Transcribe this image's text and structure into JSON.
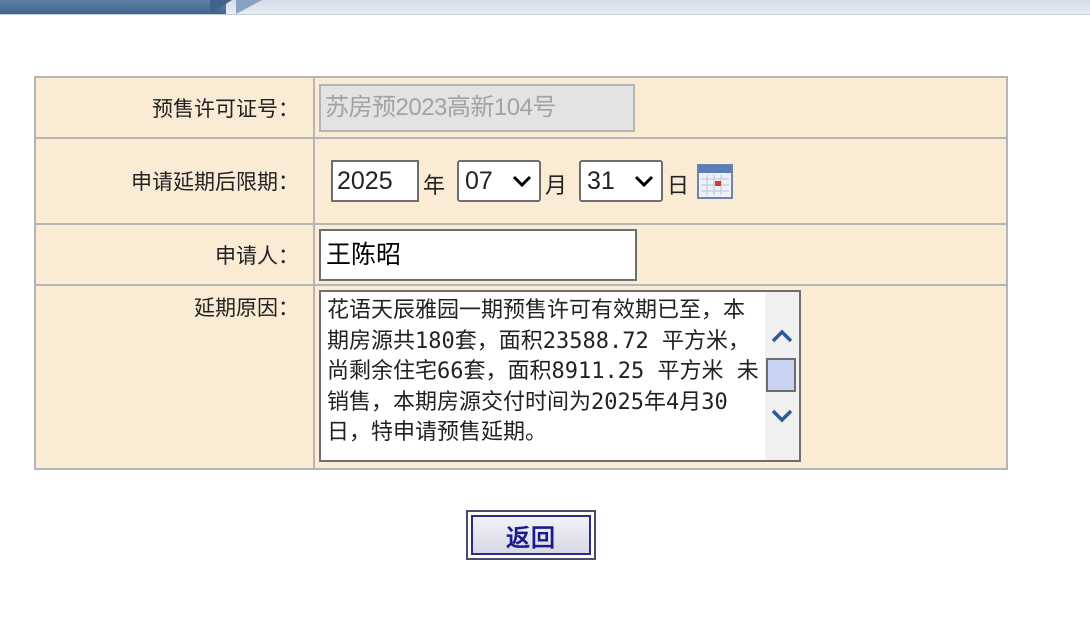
{
  "form": {
    "permit_label": "预售许可证号：",
    "permit_value": "苏房预2023高新104号",
    "deadline_label": "申请延期后限期：",
    "year_value": "2025",
    "year_unit": "年",
    "month_value": "07",
    "month_unit": "月",
    "day_value": "31",
    "day_unit": "日",
    "applicant_label": "申请人：",
    "applicant_value": "王陈昭",
    "reason_label": "延期原因：",
    "reason_value": "花语天辰雅园一期预售许可有效期已至，本期房源共180套，面积23588.72 平方米，尚剩余住宅66套，面积8911.25 平方米 未销售，本期房源交付时间为2025年4月30日，特申请预售延期。"
  },
  "actions": {
    "back_label": "返回"
  },
  "icons": {
    "calendar": "calendar-icon",
    "dropdown": "chevron-down-icon",
    "scroll_up": "chevron-up-icon",
    "scroll_down": "chevron-down-icon"
  },
  "colors": {
    "form_background": "#faebd5",
    "button_text": "#1b1b8c",
    "scroll_thumb": "#c9d4f5"
  }
}
